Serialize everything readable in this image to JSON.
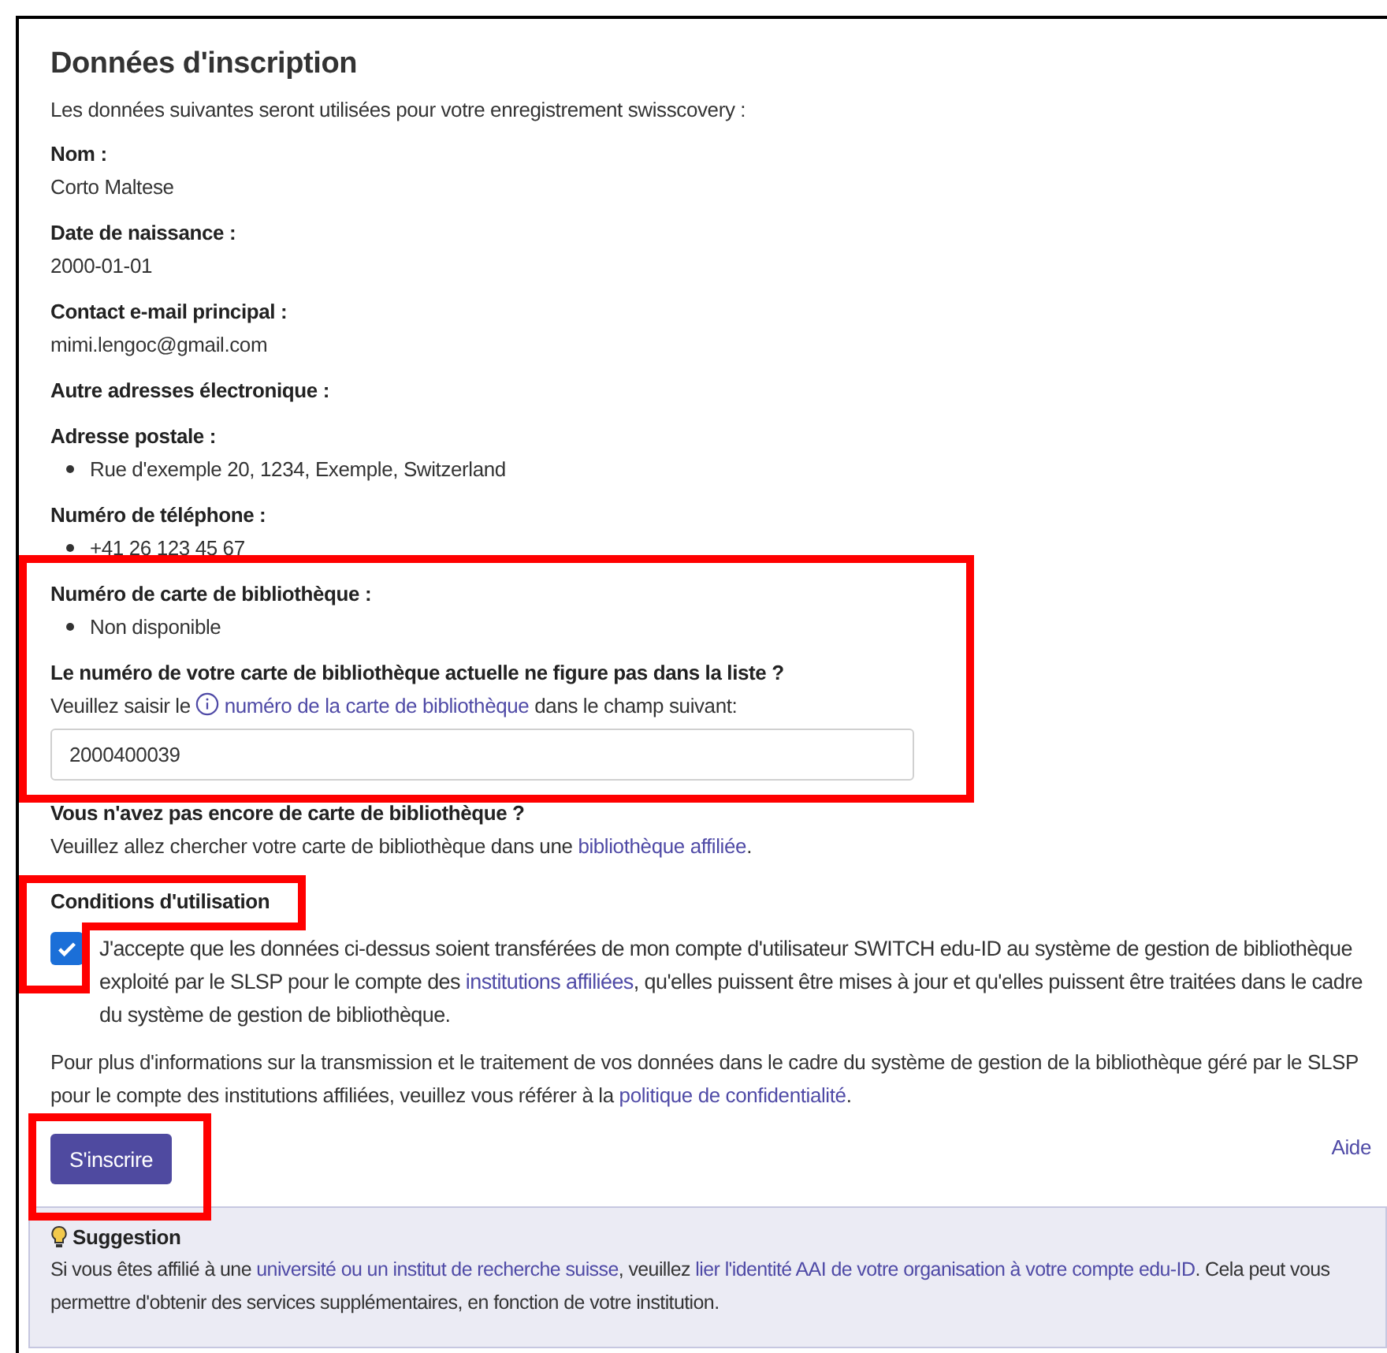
{
  "title": "Données d'inscription",
  "intro": "Les données suivantes seront utilisées pour votre enregistrement swisscovery :",
  "fields": [
    {
      "kind": "value",
      "label": "Nom :",
      "value": "Corto Maltese"
    },
    {
      "kind": "value",
      "label": "Date de naissance :",
      "value": "2000-01-01"
    },
    {
      "kind": "value",
      "label": "Contact e-mail principal :",
      "value": "mimi.lengoc@gmail.com"
    },
    {
      "kind": "empty",
      "label": "Autre adresses électronique :"
    },
    {
      "kind": "list",
      "label": "Adresse postale :",
      "items": [
        "Rue d'exemple 20, 1234, Exemple, Switzerland"
      ]
    },
    {
      "kind": "list",
      "label": "Numéro de téléphone :",
      "items": [
        "+41 26 123 45 67"
      ]
    }
  ],
  "library_card": {
    "label": "Numéro de carte de bibliothèque :",
    "items": [
      "Non disponible"
    ],
    "question": "Le numéro de votre carte de bibliothèque actuelle ne figure pas dans la liste ?",
    "instruction": [
      {
        "kind": "text",
        "text": "Veuillez saisir le "
      },
      {
        "kind": "info-link",
        "text": "numéro de la carte de bibliothèque"
      },
      {
        "kind": "text",
        "text": " dans le champ suivant:"
      }
    ],
    "input": {
      "value": "2000400039"
    }
  },
  "no_card": {
    "question": "Vous n'avez pas encore de carte de bibliothèque ?",
    "sentence": [
      {
        "kind": "text",
        "text": "Veuillez allez chercher votre carte de bibliothèque dans une "
      },
      {
        "kind": "link",
        "text": "bibliothèque affiliée"
      },
      {
        "kind": "text",
        "text": "."
      }
    ]
  },
  "terms": {
    "heading": "Conditions d'utilisation",
    "checked": true,
    "sentence": [
      {
        "kind": "text",
        "text": "J'accepte que les données ci-dessus soient transférées de mon compte d'utilisateur SWITCH edu-ID au système de gestion de bibliothèque exploité par le SLSP pour le compte des "
      },
      {
        "kind": "link",
        "text": "institutions affiliées"
      },
      {
        "kind": "text",
        "text": ", qu'elles puissent être mises à jour et qu'elles puissent être traitées dans le cadre du système de gestion de bibliothèque."
      }
    ],
    "info": [
      {
        "kind": "text",
        "text": "Pour plus d'informations sur la transmission et le traitement de vos données dans le cadre du système de gestion de la bibliothèque géré par le SLSP pour le compte des institutions affiliées, veuillez vous référer à la "
      },
      {
        "kind": "link",
        "text": "politique de confidentialité"
      },
      {
        "kind": "text",
        "text": "."
      }
    ]
  },
  "submit_button": "S'inscrire",
  "help_link": "Aide",
  "suggestion": {
    "title": "Suggestion",
    "sentence": [
      {
        "kind": "text",
        "text": "Si vous êtes affilié à une "
      },
      {
        "kind": "link",
        "text": "université ou un institut de recherche suisse"
      },
      {
        "kind": "text",
        "text": ", veuillez "
      },
      {
        "kind": "link",
        "text": "lier l'identité AAI de votre organisation à votre compte edu-ID"
      },
      {
        "kind": "text",
        "text": ". Cela peut vous permettre d'obtenir des services supplémentaires, en fonction de votre institution."
      }
    ]
  }
}
